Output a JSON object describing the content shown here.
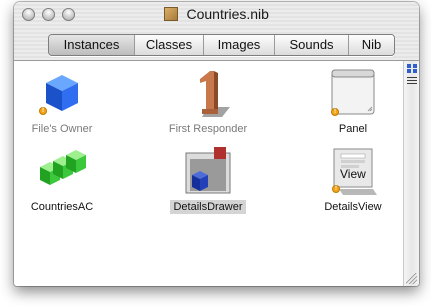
{
  "window": {
    "title": "Countries.nib",
    "title_icon": "nib-file-icon",
    "controls": [
      "close-button",
      "minimize-button",
      "zoom-button"
    ]
  },
  "tabs": [
    {
      "id": "instances",
      "label": "Instances",
      "selected": true
    },
    {
      "id": "classes",
      "label": "Classes",
      "selected": false
    },
    {
      "id": "images",
      "label": "Images",
      "selected": false
    },
    {
      "id": "sounds",
      "label": "Sounds",
      "selected": false
    },
    {
      "id": "nib",
      "label": "Nib",
      "selected": false
    }
  ],
  "items": [
    {
      "id": "files-owner",
      "label": "File's Owner",
      "icon": "blue-cube-icon",
      "label_style": "dim",
      "warning": true
    },
    {
      "id": "first-responder",
      "label": "First Responder",
      "icon": "number-one-icon",
      "label_style": "dim",
      "warning": false
    },
    {
      "id": "panel",
      "label": "Panel",
      "icon": "panel-window-icon",
      "label_style": "dark",
      "warning": true
    },
    {
      "id": "countries-ac",
      "label": "CountriesAC",
      "icon": "array-controller-icon",
      "label_style": "dark",
      "warning": false
    },
    {
      "id": "details-drawer",
      "label": "DetailsDrawer",
      "icon": "drawer-icon",
      "label_style": "selected",
      "warning": false
    },
    {
      "id": "details-view",
      "label": "DetailsView",
      "icon": "custom-view-icon",
      "label_style": "dark",
      "warning": true,
      "icon_text": "View"
    }
  ],
  "colors": {
    "warning_badge": "#f2a417",
    "selection_highlight": "#d4d4d4",
    "dim_label": "#7a7a7a"
  }
}
